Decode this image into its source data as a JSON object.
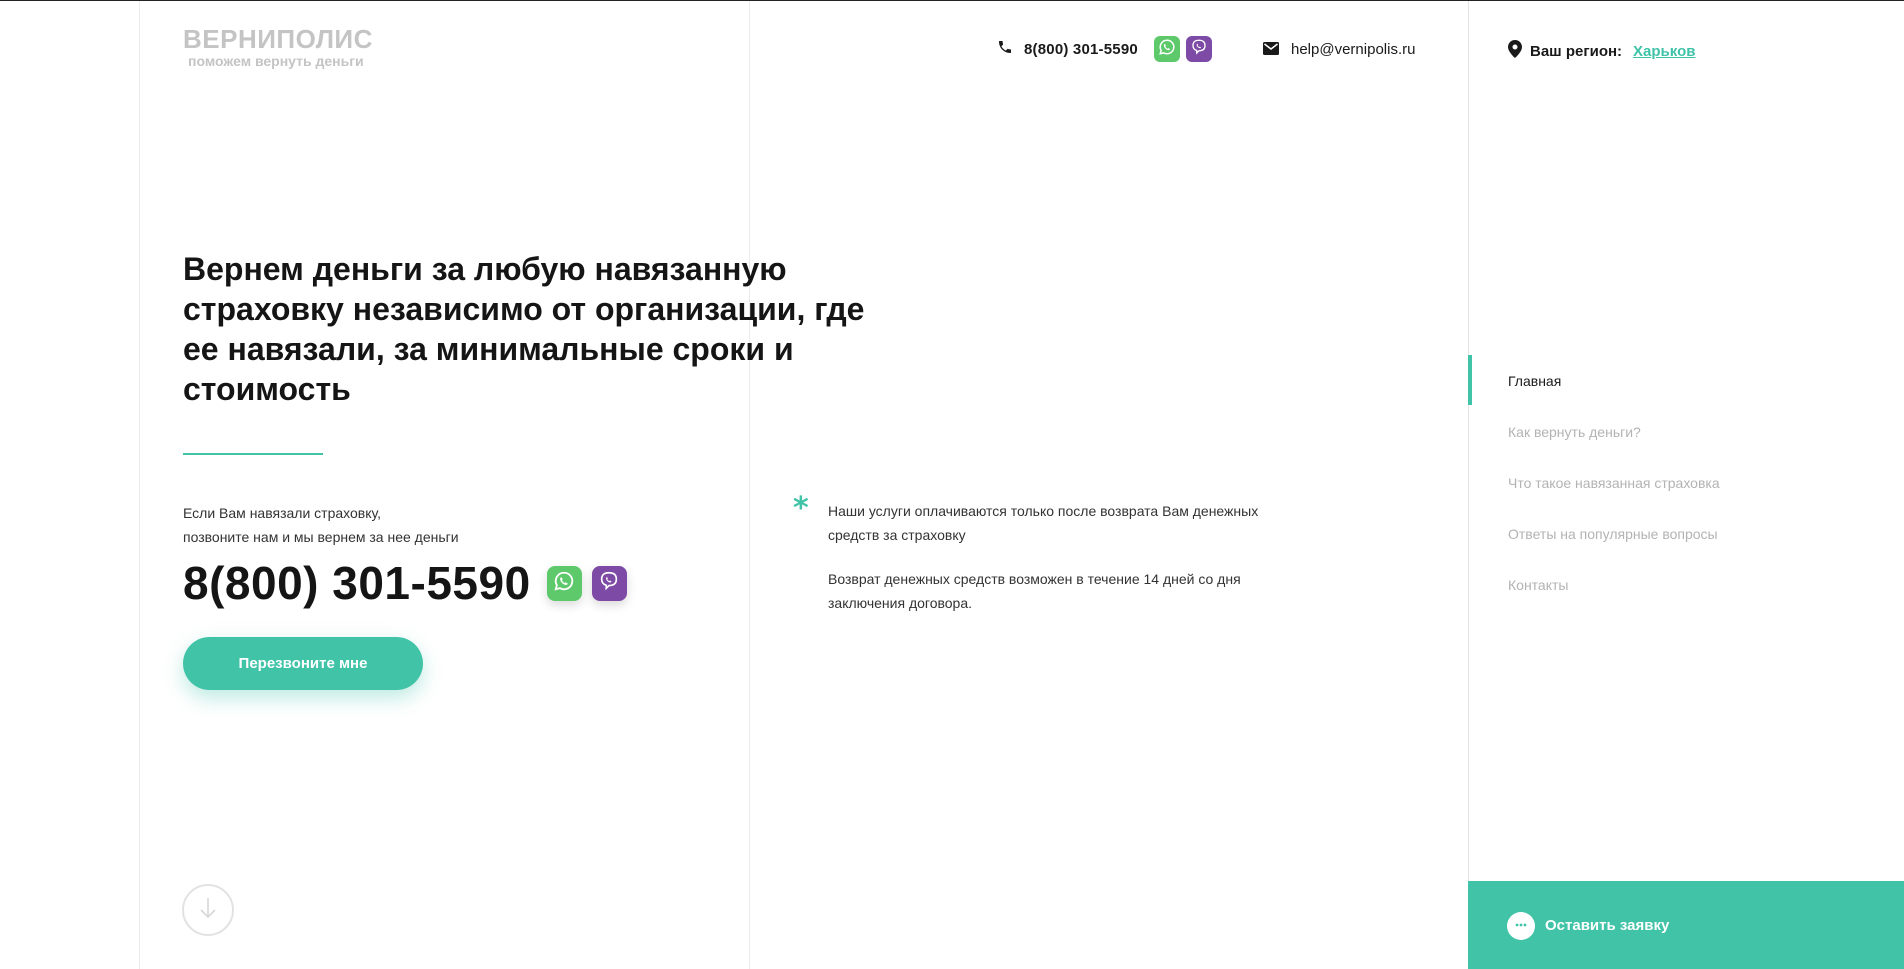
{
  "header": {
    "logo_title": "ВЕРНИПОЛИС",
    "logo_subtitle": "поможем вернуть деньги",
    "phone": "8(800) 301-5590",
    "email": "help@vernipolis.ru",
    "region_label": "Ваш регион:",
    "region_city": "Харьков"
  },
  "hero": {
    "title": "Вернем деньги за любую навязанную страховку независимо от организации, где ее навязали, за минимальные сроки и стоимость",
    "lead_line1": "Если Вам навязали страховку,",
    "lead_line2": "позвоните нам и мы вернем за нее деньги",
    "phone": "8(800) 301-5590",
    "cta_label": "Перезвоните мне"
  },
  "notes": {
    "asterisk": "*",
    "note1": "Наши услуги оплачиваются только после возврата Вам денежных средств за страховку",
    "note2": "Возврат денежных средств возможен в течение 14 дней со дня заключения договора."
  },
  "side_nav": {
    "items": [
      {
        "label": "Главная",
        "active": true
      },
      {
        "label": "Как вернуть деньги?",
        "active": false
      },
      {
        "label": "Что такое навязанная страховка",
        "active": false
      },
      {
        "label": "Ответы на популярные вопросы",
        "active": false
      },
      {
        "label": "Контакты",
        "active": false
      }
    ]
  },
  "request": {
    "label": "Оставить заявку"
  },
  "icons": [
    "phone-icon",
    "whatsapp-icon",
    "viber-icon",
    "mail-icon",
    "location-pin-icon",
    "arrow-down-icon",
    "chat-icon"
  ],
  "colors": {
    "accent": "#41c3a8",
    "whatsapp": "#5ec96b",
    "viber": "#7d4aa5",
    "logo_gray": "#c4c4c4"
  }
}
